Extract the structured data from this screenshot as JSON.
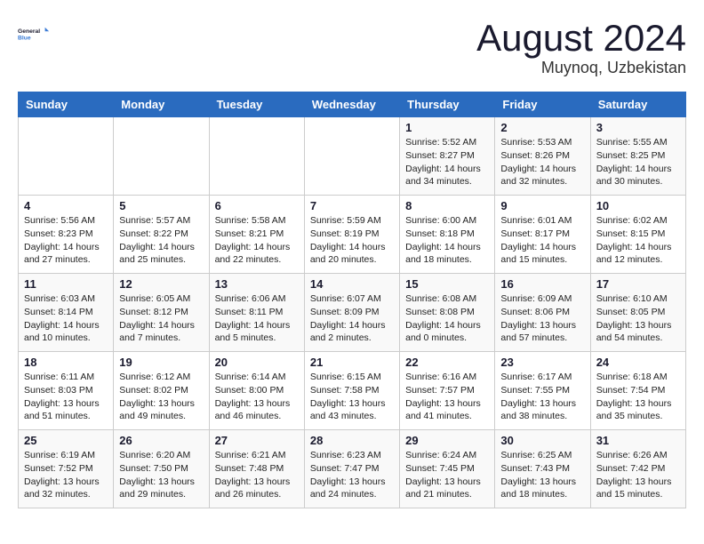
{
  "header": {
    "logo_line1": "General",
    "logo_line2": "Blue",
    "month": "August 2024",
    "location": "Muynoq, Uzbekistan"
  },
  "days_of_week": [
    "Sunday",
    "Monday",
    "Tuesday",
    "Wednesday",
    "Thursday",
    "Friday",
    "Saturday"
  ],
  "weeks": [
    [
      {
        "day": "",
        "info": ""
      },
      {
        "day": "",
        "info": ""
      },
      {
        "day": "",
        "info": ""
      },
      {
        "day": "",
        "info": ""
      },
      {
        "day": "1",
        "info": "Sunrise: 5:52 AM\nSunset: 8:27 PM\nDaylight: 14 hours\nand 34 minutes."
      },
      {
        "day": "2",
        "info": "Sunrise: 5:53 AM\nSunset: 8:26 PM\nDaylight: 14 hours\nand 32 minutes."
      },
      {
        "day": "3",
        "info": "Sunrise: 5:55 AM\nSunset: 8:25 PM\nDaylight: 14 hours\nand 30 minutes."
      }
    ],
    [
      {
        "day": "4",
        "info": "Sunrise: 5:56 AM\nSunset: 8:23 PM\nDaylight: 14 hours\nand 27 minutes."
      },
      {
        "day": "5",
        "info": "Sunrise: 5:57 AM\nSunset: 8:22 PM\nDaylight: 14 hours\nand 25 minutes."
      },
      {
        "day": "6",
        "info": "Sunrise: 5:58 AM\nSunset: 8:21 PM\nDaylight: 14 hours\nand 22 minutes."
      },
      {
        "day": "7",
        "info": "Sunrise: 5:59 AM\nSunset: 8:19 PM\nDaylight: 14 hours\nand 20 minutes."
      },
      {
        "day": "8",
        "info": "Sunrise: 6:00 AM\nSunset: 8:18 PM\nDaylight: 14 hours\nand 18 minutes."
      },
      {
        "day": "9",
        "info": "Sunrise: 6:01 AM\nSunset: 8:17 PM\nDaylight: 14 hours\nand 15 minutes."
      },
      {
        "day": "10",
        "info": "Sunrise: 6:02 AM\nSunset: 8:15 PM\nDaylight: 14 hours\nand 12 minutes."
      }
    ],
    [
      {
        "day": "11",
        "info": "Sunrise: 6:03 AM\nSunset: 8:14 PM\nDaylight: 14 hours\nand 10 minutes."
      },
      {
        "day": "12",
        "info": "Sunrise: 6:05 AM\nSunset: 8:12 PM\nDaylight: 14 hours\nand 7 minutes."
      },
      {
        "day": "13",
        "info": "Sunrise: 6:06 AM\nSunset: 8:11 PM\nDaylight: 14 hours\nand 5 minutes."
      },
      {
        "day": "14",
        "info": "Sunrise: 6:07 AM\nSunset: 8:09 PM\nDaylight: 14 hours\nand 2 minutes."
      },
      {
        "day": "15",
        "info": "Sunrise: 6:08 AM\nSunset: 8:08 PM\nDaylight: 14 hours\nand 0 minutes."
      },
      {
        "day": "16",
        "info": "Sunrise: 6:09 AM\nSunset: 8:06 PM\nDaylight: 13 hours\nand 57 minutes."
      },
      {
        "day": "17",
        "info": "Sunrise: 6:10 AM\nSunset: 8:05 PM\nDaylight: 13 hours\nand 54 minutes."
      }
    ],
    [
      {
        "day": "18",
        "info": "Sunrise: 6:11 AM\nSunset: 8:03 PM\nDaylight: 13 hours\nand 51 minutes."
      },
      {
        "day": "19",
        "info": "Sunrise: 6:12 AM\nSunset: 8:02 PM\nDaylight: 13 hours\nand 49 minutes."
      },
      {
        "day": "20",
        "info": "Sunrise: 6:14 AM\nSunset: 8:00 PM\nDaylight: 13 hours\nand 46 minutes."
      },
      {
        "day": "21",
        "info": "Sunrise: 6:15 AM\nSunset: 7:58 PM\nDaylight: 13 hours\nand 43 minutes."
      },
      {
        "day": "22",
        "info": "Sunrise: 6:16 AM\nSunset: 7:57 PM\nDaylight: 13 hours\nand 41 minutes."
      },
      {
        "day": "23",
        "info": "Sunrise: 6:17 AM\nSunset: 7:55 PM\nDaylight: 13 hours\nand 38 minutes."
      },
      {
        "day": "24",
        "info": "Sunrise: 6:18 AM\nSunset: 7:54 PM\nDaylight: 13 hours\nand 35 minutes."
      }
    ],
    [
      {
        "day": "25",
        "info": "Sunrise: 6:19 AM\nSunset: 7:52 PM\nDaylight: 13 hours\nand 32 minutes."
      },
      {
        "day": "26",
        "info": "Sunrise: 6:20 AM\nSunset: 7:50 PM\nDaylight: 13 hours\nand 29 minutes."
      },
      {
        "day": "27",
        "info": "Sunrise: 6:21 AM\nSunset: 7:48 PM\nDaylight: 13 hours\nand 26 minutes."
      },
      {
        "day": "28",
        "info": "Sunrise: 6:23 AM\nSunset: 7:47 PM\nDaylight: 13 hours\nand 24 minutes."
      },
      {
        "day": "29",
        "info": "Sunrise: 6:24 AM\nSunset: 7:45 PM\nDaylight: 13 hours\nand 21 minutes."
      },
      {
        "day": "30",
        "info": "Sunrise: 6:25 AM\nSunset: 7:43 PM\nDaylight: 13 hours\nand 18 minutes."
      },
      {
        "day": "31",
        "info": "Sunrise: 6:26 AM\nSunset: 7:42 PM\nDaylight: 13 hours\nand 15 minutes."
      }
    ]
  ]
}
